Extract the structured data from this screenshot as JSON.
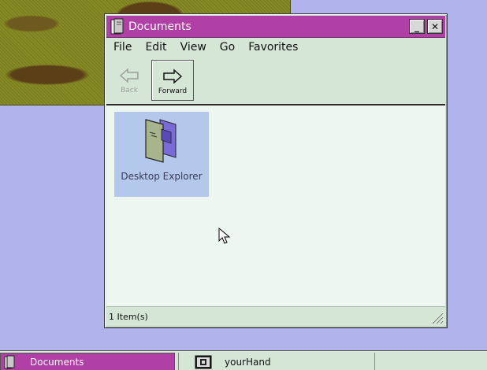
{
  "window": {
    "title": "Documents",
    "title_icon": "document-book-icon",
    "controls": {
      "minimize": "_",
      "close": "✕"
    },
    "colors": {
      "titlebar": "#b140a6",
      "frame": "#d6e6d6",
      "content": "#eef6f2",
      "selection": "#b4c8ec"
    }
  },
  "menubar": {
    "items": [
      "File",
      "Edit",
      "View",
      "Go",
      "Favorites"
    ]
  },
  "toolbar": {
    "back_label": "Back",
    "forward_label": "Forward"
  },
  "content": {
    "items": [
      {
        "name": "Desktop Explorer",
        "icon": "folder-document-icon",
        "selected": true
      }
    ]
  },
  "status": {
    "text": "1 Item(s)"
  },
  "taskbar": {
    "tasks": [
      {
        "label": "Documents",
        "icon": "document-book-icon",
        "active": true
      },
      {
        "label": "yourHand",
        "icon": "terminal-icon",
        "active": false
      }
    ]
  }
}
